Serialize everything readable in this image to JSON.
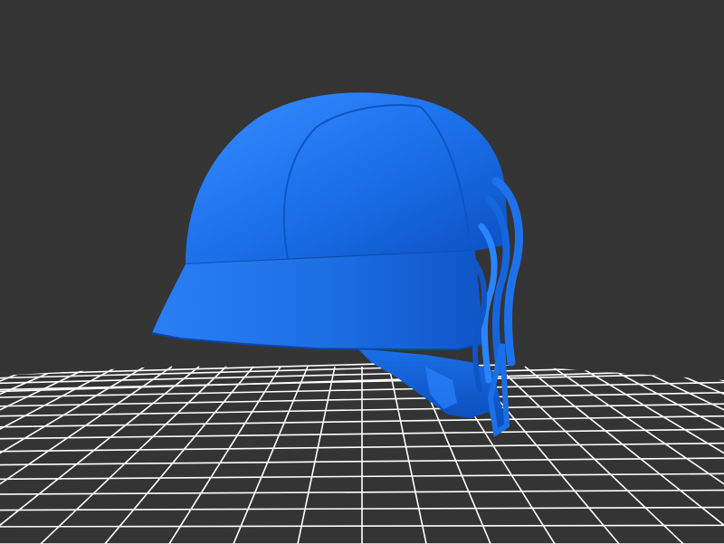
{
  "scene": {
    "background_color": "#343434",
    "grid_color": "#ffffff",
    "model_color": "#1a6fe6",
    "model_highlight": "#3b8dff",
    "model_shadow": "#0b3f9c",
    "object": "helmet-3d-model"
  }
}
